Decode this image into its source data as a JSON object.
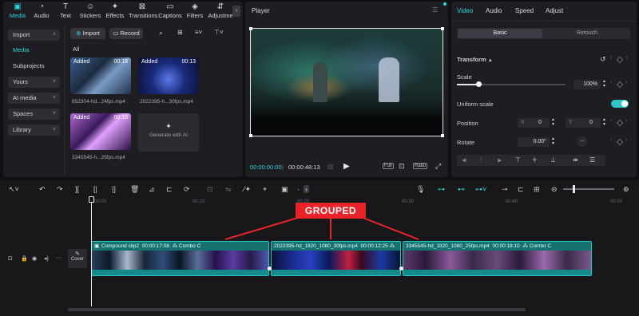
{
  "toolbar": {
    "tabs": [
      {
        "label": "Media",
        "icon": "media-icon",
        "active": true
      },
      {
        "label": "Audio",
        "icon": "audio-icon"
      },
      {
        "label": "Text",
        "icon": "text-icon"
      },
      {
        "label": "Stickers",
        "icon": "stickers-icon"
      },
      {
        "label": "Effects",
        "icon": "effects-icon"
      },
      {
        "label": "Transitions",
        "icon": "transitions-icon"
      },
      {
        "label": "Captions",
        "icon": "captions-icon"
      },
      {
        "label": "Filters",
        "icon": "filters-icon"
      },
      {
        "label": "Adjustme",
        "icon": "adjustment-icon"
      }
    ]
  },
  "sidebar": {
    "items": [
      {
        "label": "Import",
        "selected": true
      },
      {
        "label": "Media"
      },
      {
        "label": "Subprojects"
      },
      {
        "label": "Yours"
      },
      {
        "label": "AI media"
      },
      {
        "label": "Spaces"
      },
      {
        "label": "Library"
      }
    ]
  },
  "media": {
    "import_label": "Import",
    "record_label": "Record",
    "filter_label": "All",
    "items": [
      {
        "added": "Added",
        "duration": "00:18",
        "name": "852304-hd...24fps.mp4"
      },
      {
        "added": "Added",
        "duration": "00:13",
        "name": "2022395-h...30fps.mp4"
      },
      {
        "added": "Added",
        "duration": "00:19",
        "name": "3345545-h...25fps.mp4"
      }
    ],
    "generate_label": "Generate with AI"
  },
  "player": {
    "title": "Player",
    "current_time": "00:00:00:00",
    "total_time": "00:00:48:13",
    "full_label": "Full",
    "ratio_label": "Ratio"
  },
  "inspector": {
    "tabs": [
      "Video",
      "Audio",
      "Speed",
      "Adjust"
    ],
    "subtabs": [
      "Basic",
      "Retouch"
    ],
    "transform_label": "Transform",
    "scale_label": "Scale",
    "scale_value": "100%",
    "scale_fraction": 0.2,
    "uniform_label": "Uniform scale",
    "uniform_on": true,
    "position_label": "Position",
    "pos_x_label": "X",
    "pos_x": "0",
    "pos_y_label": "Y",
    "pos_y": "0",
    "rotate_label": "Rotate",
    "rotate_value": "0.00°"
  },
  "timeline": {
    "ruler": [
      "00:00",
      "00:10",
      "00:20",
      "00:30",
      "00:40",
      "00:50"
    ],
    "cover_label": "Cover",
    "annotation": "GROUPED",
    "clips": [
      {
        "name": "Compound clip2",
        "duration": "00:00:17:08",
        "group": "Combo C"
      },
      {
        "name": "2022395-hd_1920_1080_30fps.mp4",
        "duration": "00:00:12:25",
        "group": ""
      },
      {
        "name": "3345545-hd_1920_1080_25fps.mp4",
        "duration": "00:00:18:10",
        "group": "Combo C"
      }
    ]
  }
}
